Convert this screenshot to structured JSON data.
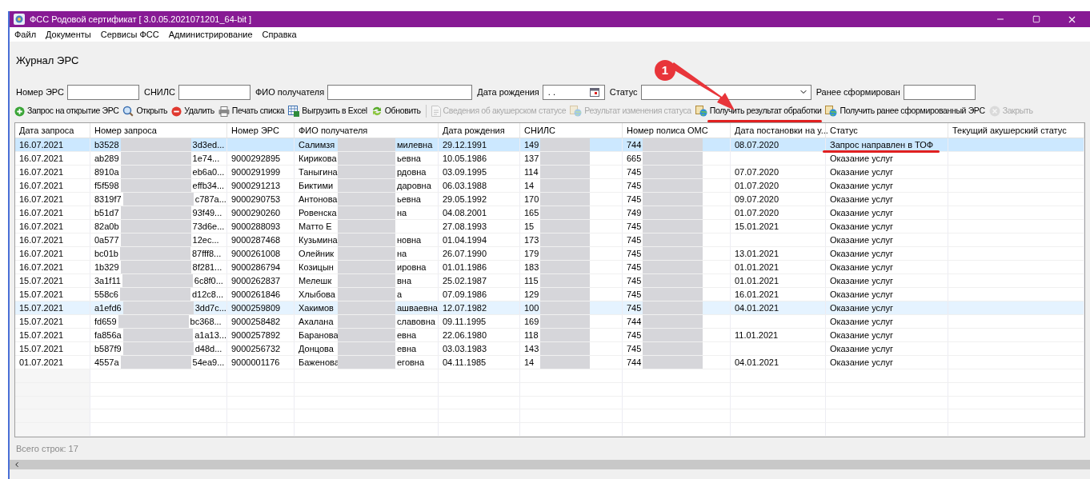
{
  "window": {
    "title": "ФСС Родовой сертификат  [ 3.0.05.2021071201_64-bit ]"
  },
  "menu": [
    "Файл",
    "Документы",
    "Сервисы ФСС",
    "Администрирование",
    "Справка"
  ],
  "page_title": "Журнал ЭРС",
  "filters": [
    {
      "kind": "text",
      "label": "Номер ЭРС"
    },
    {
      "kind": "text",
      "label": "СНИЛС"
    },
    {
      "kind": "text",
      "label": "ФИО получателя"
    },
    {
      "kind": "date",
      "label": "Дата рождения",
      "value": ". ."
    },
    {
      "kind": "select",
      "label": "Статус"
    },
    {
      "kind": "text",
      "label": "Ранее сформирован"
    }
  ],
  "toolbar": [
    {
      "label": "Запрос на открытие ЭРС",
      "disabled": false,
      "underlined": false
    },
    {
      "label": "Открыть",
      "disabled": false,
      "underlined": false
    },
    {
      "label": "Удалить",
      "disabled": false,
      "underlined": false
    },
    {
      "label": "Печать списка",
      "disabled": false,
      "underlined": false
    },
    {
      "label": "Выгрузить в Excel",
      "disabled": false,
      "underlined": false
    },
    {
      "label": "Обновить",
      "disabled": false,
      "underlined": false
    },
    {
      "kind": "separator"
    },
    {
      "label": "Сведения об акушерском статусе",
      "disabled": true,
      "underlined": false
    },
    {
      "label": "Результат изменения статуса",
      "disabled": true,
      "underlined": false
    },
    {
      "label": "Получить результат обработки",
      "disabled": false,
      "underlined": true
    },
    {
      "label": "Получить ранее сформированный ЭРС",
      "disabled": false,
      "underlined": false
    },
    {
      "label": "Закрыть",
      "disabled": true,
      "underlined": false
    }
  ],
  "annotation": {
    "badge": "1"
  },
  "table": {
    "columns": [
      "Дата запроса",
      "Номер запроса",
      "Номер ЭРС",
      "ФИО получателя",
      "Дата рождения",
      "СНИЛС",
      "Номер полиса ОМС",
      "Дата постановки на у...",
      "Статус",
      "Текущий акушерский статус"
    ],
    "rows": [
      {
        "date": "16.07.2021",
        "req_start": "b3528",
        "req_end": "3d3ed...",
        "ers": "",
        "fio_start": "Салимзя",
        "fio_end": "милевна",
        "birth": "29.12.1991",
        "snils": "149",
        "oms": "744",
        "reg": "08.07.2020",
        "status": "Запрос направлен в ТОФ",
        "status_underlined": true,
        "selected": true,
        "hovered": false
      },
      {
        "date": "16.07.2021",
        "req_start": "ab289",
        "req_end": "1e74...",
        "ers": "9000292895",
        "fio_start": "Кирикова",
        "fio_end": "ьевна",
        "birth": "10.05.1986",
        "snils": "137",
        "oms": "665",
        "reg": "",
        "status": "Оказание услуг",
        "status_underlined": false,
        "selected": false,
        "hovered": false
      },
      {
        "date": "16.07.2021",
        "req_start": "8910a",
        "req_end": "eb6a0...",
        "ers": "9000291999",
        "fio_start": "Таныгина",
        "fio_end": "рдовна",
        "birth": "03.09.1995",
        "snils": "114",
        "oms": "745",
        "reg": "07.07.2020",
        "status": "Оказание услуг",
        "status_underlined": false,
        "selected": false,
        "hovered": false
      },
      {
        "date": "16.07.2021",
        "req_start": "f5f598",
        "req_end": "effb34...",
        "ers": "9000291213",
        "fio_start": "Биктими",
        "fio_end": "даровна",
        "birth": "06.03.1988",
        "snils": "14",
        "oms": "745",
        "reg": "01.07.2020",
        "status": "Оказание услуг",
        "status_underlined": false,
        "selected": false,
        "hovered": false
      },
      {
        "date": "16.07.2021",
        "req_start": "8319f7",
        "req_end": "c787a...",
        "ers": "9000290753",
        "fio_start": "Антонова",
        "fio_end": "ьевна",
        "birth": "29.05.1992",
        "snils": "170",
        "oms": "745",
        "reg": "09.07.2020",
        "status": "Оказание услуг",
        "status_underlined": false,
        "selected": false,
        "hovered": false
      },
      {
        "date": "16.07.2021",
        "req_start": "b51d7",
        "req_end": "93f49...",
        "ers": "9000290260",
        "fio_start": "Ровенска",
        "fio_end": "на",
        "birth": "04.08.2001",
        "snils": "165",
        "oms": "749",
        "reg": "01.07.2020",
        "status": "Оказание услуг",
        "status_underlined": false,
        "selected": false,
        "hovered": false
      },
      {
        "date": "16.07.2021",
        "req_start": "82a0b",
        "req_end": "73d6e...",
        "ers": "9000288093",
        "fio_start": "Матто Е",
        "fio_end": "",
        "birth": "27.08.1993",
        "snils": "15",
        "oms": "745",
        "reg": "15.01.2021",
        "status": "Оказание услуг",
        "status_underlined": false,
        "selected": false,
        "hovered": false
      },
      {
        "date": "16.07.2021",
        "req_start": "0a577",
        "req_end": "12ec...",
        "ers": "9000287468",
        "fio_start": "Кузьмина",
        "fio_end": "новна",
        "birth": "01.04.1994",
        "snils": "173",
        "oms": "745",
        "reg": "",
        "status": "Оказание услуг",
        "status_underlined": false,
        "selected": false,
        "hovered": false
      },
      {
        "date": "16.07.2021",
        "req_start": "bc01b",
        "req_end": "87fff8...",
        "ers": "9000261008",
        "fio_start": "Олейник",
        "fio_end": "на",
        "birth": "26.07.1990",
        "snils": "179",
        "oms": "745",
        "reg": "13.01.2021",
        "status": "Оказание услуг",
        "status_underlined": false,
        "selected": false,
        "hovered": false
      },
      {
        "date": "16.07.2021",
        "req_start": "1b329",
        "req_end": "8f281...",
        "ers": "9000286794",
        "fio_start": "Козицын",
        "fio_end": "ировна",
        "birth": "01.01.1986",
        "snils": "183",
        "oms": "745",
        "reg": "01.01.2021",
        "status": "Оказание услуг",
        "status_underlined": false,
        "selected": false,
        "hovered": false
      },
      {
        "date": "15.07.2021",
        "req_start": "3a1f11",
        "req_end": "6c8f0...",
        "ers": "9000262837",
        "fio_start": "Мелешк",
        "fio_end": "вна",
        "birth": "25.02.1987",
        "snils": "115",
        "oms": "745",
        "reg": "01.01.2021",
        "status": "Оказание услуг",
        "status_underlined": false,
        "selected": false,
        "hovered": false
      },
      {
        "date": "15.07.2021",
        "req_start": "558c6",
        "req_end": "d12c8...",
        "ers": "9000261846",
        "fio_start": "Хлыбова",
        "fio_end": "а",
        "birth": "07.09.1986",
        "snils": "129",
        "oms": "745",
        "reg": "16.01.2021",
        "status": "Оказание услуг",
        "status_underlined": false,
        "selected": false,
        "hovered": false
      },
      {
        "date": "15.07.2021",
        "req_start": "a1efd6",
        "req_end": "3dd7c...",
        "ers": "9000259809",
        "fio_start": "Хакимов",
        "fio_end": "ашваевна",
        "birth": "12.07.1982",
        "snils": "100",
        "oms": "745",
        "reg": "04.01.2021",
        "status": "Оказание услуг",
        "status_underlined": false,
        "selected": false,
        "hovered": true
      },
      {
        "date": "15.07.2021",
        "req_start": "fd659",
        "req_end": "bc368...",
        "ers": "9000258482",
        "fio_start": "Ахалана",
        "fio_end": "славовна",
        "birth": "09.11.1995",
        "snils": "169",
        "oms": "744",
        "reg": "",
        "status": "Оказание услуг",
        "status_underlined": false,
        "selected": false,
        "hovered": false
      },
      {
        "date": "15.07.2021",
        "req_start": "fa856a",
        "req_end": "a1a13...",
        "ers": "9000257892",
        "fio_start": "Баранова",
        "fio_end": "евна",
        "birth": "22.06.1980",
        "snils": "118",
        "oms": "745",
        "reg": "11.01.2021",
        "status": "Оказание услуг",
        "status_underlined": false,
        "selected": false,
        "hovered": false
      },
      {
        "date": "15.07.2021",
        "req_start": "b587f9",
        "req_end": "d48d...",
        "ers": "9000256732",
        "fio_start": "Донцова",
        "fio_end": "евна",
        "birth": "03.03.1983",
        "snils": "143",
        "oms": "745",
        "reg": "",
        "status": "Оказание услуг",
        "status_underlined": false,
        "selected": false,
        "hovered": false
      },
      {
        "date": "01.07.2021",
        "req_start": "4557a",
        "req_end": "54ea9...",
        "ers": "9000001176",
        "fio_start": "Баженова",
        "fio_end": "еговна",
        "birth": "04.11.1985",
        "snils": "14",
        "oms": "744",
        "reg": "04.01.2021",
        "status": "Оказание услуг",
        "status_underlined": false,
        "selected": false,
        "hovered": false
      }
    ]
  },
  "status_bar": "Всего строк: 17"
}
